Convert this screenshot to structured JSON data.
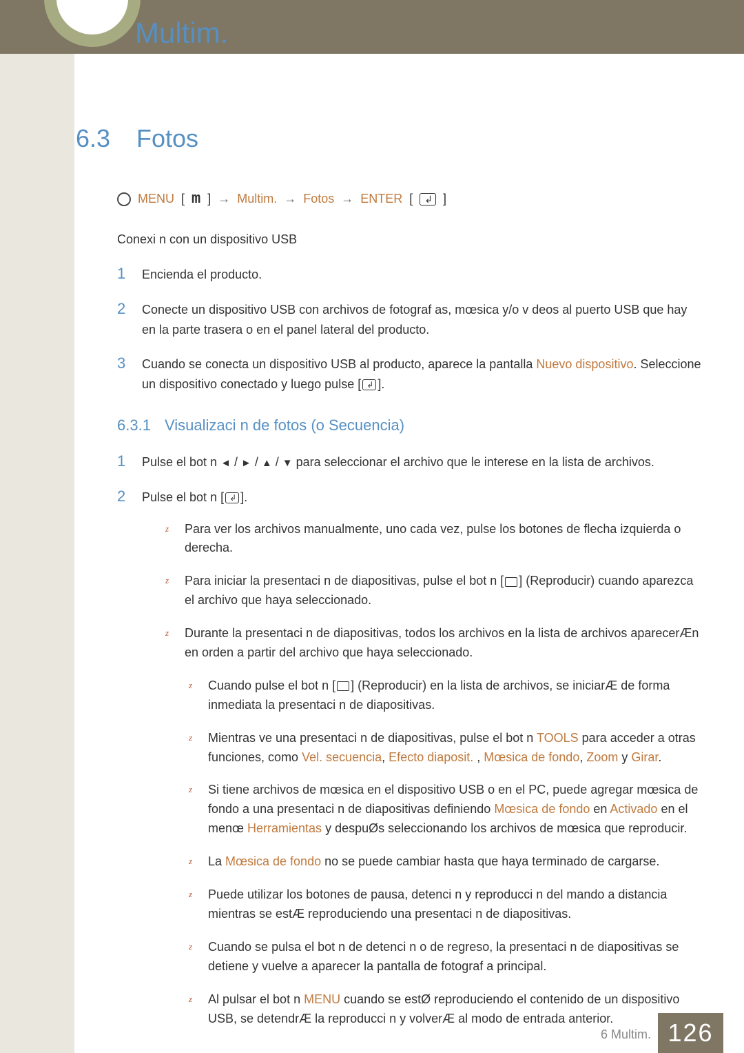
{
  "header": {
    "chapter_title": "Multim."
  },
  "section": {
    "number": "6.3",
    "title": "Fotos"
  },
  "menu_path": {
    "menu": "MENU",
    "m": "m",
    "arrow": "→",
    "multim": "Multim.",
    "fotos": "Fotos",
    "enter": "ENTER"
  },
  "intro": "Conexi n con un dispositivo USB",
  "steps": [
    {
      "n": "1",
      "text": "Encienda el producto."
    },
    {
      "n": "2",
      "text": "Conecte un dispositivo USB con archivos de fotograf as, mœsica y/o v deos al puerto USB que hay en la parte trasera o en el panel lateral del producto."
    },
    {
      "n": "3",
      "text_before": "Cuando se conecta un dispositivo USB al producto, aparece la pantalla ",
      "highlight": "Nuevo dispositivo",
      "text_after": ". Seleccione un dispositivo conectado y luego pulse",
      "text_tail": "]."
    }
  ],
  "subsection": {
    "number": "6.3.1",
    "title": "Visualizaci n de fotos (o Secuencia)"
  },
  "sub_steps": [
    {
      "n": "1",
      "text": "Pulse el bot n ◄ / ► / ▲ / ▼ para seleccionar el archivo que le interese en la lista de archivos."
    },
    {
      "n": "2",
      "text_before": "Pulse el bot n [",
      "text_after": "]."
    }
  ],
  "z_items": [
    "Para ver los archivos manualmente, uno cada vez, pulse los botones de flecha izquierda o derecha.",
    "Para iniciar la presentaci n de diapositivas, pulse el bot n [  ] (Reproducir) cuando aparezca el archivo que haya seleccionado.",
    "Durante la presentaci n de diapositivas, todos los archivos en la lista de archivos aparecerÆn en orden a partir del archivo que haya seleccionado."
  ],
  "inner_z": {
    "i1": {
      "pre": "Cuando pulse el bot n [",
      "mid": "] (Reproducir) en la lista de archivos, se iniciarÆ de forma inmediata la presentaci n de diapositivas."
    },
    "i2": {
      "pre": "Mientras ve una presentaci n de diapositivas, pulse el bot n ",
      "tools": "TOOLS",
      "mid": " para acceder a otras funciones, como ",
      "h1": "Vel. secuencia",
      "sep1": ", ",
      "h2": "Efecto diaposit.",
      "sep2": " , ",
      "h3": "Mœsica de fondo",
      "sep3": ", ",
      "h4": "Zoom",
      "sep4": " y ",
      "h5": "Girar",
      "tail": "."
    },
    "i3": {
      "pre": "Si tiene archivos de mœsica en el dispositivo USB o en el PC, puede agregar mœsica de fondo a una presentaci n de diapositivas definiendo ",
      "h1": "Mœsica de fondo",
      "mid1": " en ",
      "h2": "Activado",
      "mid2": " en el menœ ",
      "h3": "Herramientas",
      "tail": " y despuØs seleccionando los archivos de mœsica que reproducir."
    },
    "i4": {
      "pre": "La ",
      "h1": "Mœsica de fondo",
      "tail": " no se puede cambiar hasta que haya terminado de cargarse."
    },
    "i5": "Puede utilizar los botones de pausa, detenci n y reproducci n del mando a distancia mientras se estÆ reproduciendo una presentaci n de diapositivas.",
    "i6": "Cuando se pulsa el bot n de detenci n o de regreso, la presentaci n de diapositivas se detiene y vuelve a aparecer la pantalla de fotograf a principal.",
    "i7": {
      "pre": "Al pulsar el bot n ",
      "h1": "MENU",
      "tail": " cuando se estØ reproduciendo el contenido de un dispositivo USB, se detendrÆ la reproducci n y volverÆ al modo de entrada anterior."
    }
  },
  "footer": {
    "label": "6 Multim.",
    "page": "126"
  }
}
